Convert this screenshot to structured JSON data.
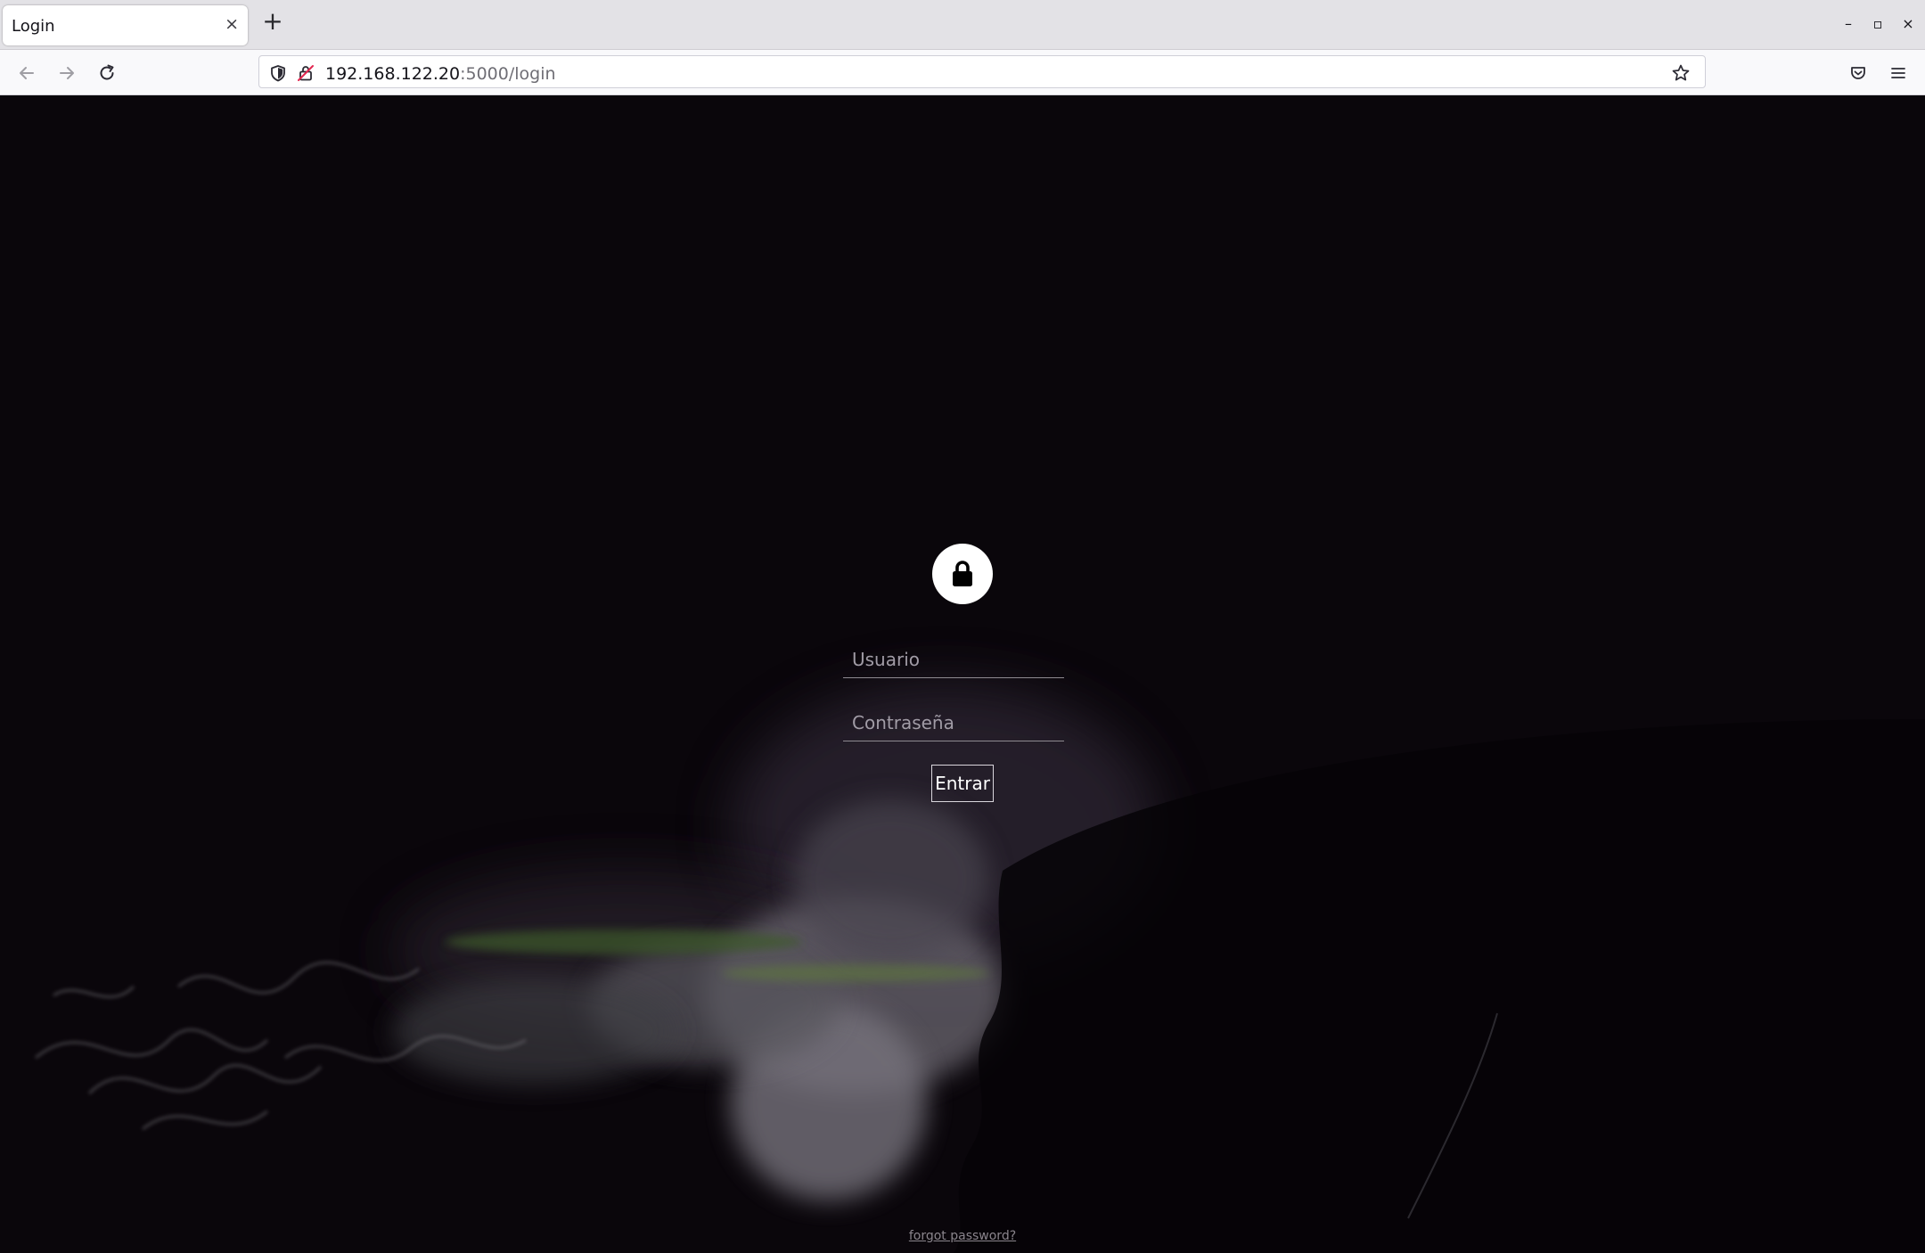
{
  "browser": {
    "tab_title": "Login",
    "tab_close_glyph": "×",
    "new_tab_glyph": "+",
    "url_host": "192.168.122.20",
    "url_path": ":5000/login",
    "window_controls": {
      "minimize": "–",
      "maximize": "▫",
      "close": "×"
    },
    "icons": [
      "back-arrow-icon",
      "forward-arrow-icon",
      "reload-icon",
      "shield-icon",
      "insecure-lock-icon",
      "star-bookmark-icon",
      "pocket-icon",
      "hamburger-menu-icon"
    ]
  },
  "login": {
    "icon": "lock-icon",
    "username_placeholder": "Usuario",
    "password_placeholder": "Contraseña",
    "submit_label": "Entrar",
    "forgot_password": "forgot password?"
  },
  "colors": {
    "page_background": "#0a060b",
    "tab_strip": "#e3e2e6",
    "toolbar": "#f9f9fb",
    "field_underline": "#8e8a90",
    "button_border": "#d9d6dc"
  }
}
